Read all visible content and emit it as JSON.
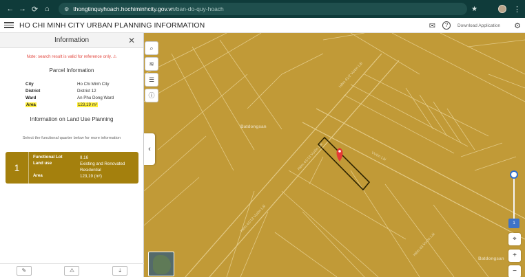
{
  "browser": {
    "url_host": "thongtinquyhoach.hochiminhcity.gov.vn",
    "url_path": "/ban-do-quy-hoach"
  },
  "app": {
    "title": "HO CHI MINH CITY URBAN PLANNING INFORMATION",
    "download_label": "Download Application"
  },
  "panel": {
    "title": "Information",
    "note": "Note: search result is valid for reference only.",
    "parcel_title": "Parcel Information",
    "parcel_rows": [
      {
        "key": "City",
        "value": "Ho Chi Minh City"
      },
      {
        "key": "District",
        "value": "District 12"
      },
      {
        "key": "Ward",
        "value": "An Phu Dong Ward"
      },
      {
        "key": "Area",
        "value": "123,19 m²"
      }
    ],
    "land_use_title": "Information on Land Use Planning",
    "hint": "Select the functional quarter below for more information",
    "lot": {
      "number": "1",
      "rows": [
        {
          "key": "Functional Lot",
          "value": "II.16"
        },
        {
          "key": "Land use",
          "value": "Existing and Renovated Residential"
        },
        {
          "key": "Area",
          "value": "123,19 (m²)"
        }
      ]
    }
  },
  "map": {
    "streets": [
      "Hẻm 41/2 Vườn Lài",
      "Hẻm 41/13 Vườn Lài",
      "Hẻm 43 Vườn Lài",
      "Vườn Lài",
      "Hẻm 41/13 Vườn Lài"
    ],
    "watermark": "Batdongsan",
    "zoom_badge": "1",
    "colors": {
      "land": "#c19a37",
      "accent": "#2f6fd0",
      "marker": "#e53935"
    }
  }
}
